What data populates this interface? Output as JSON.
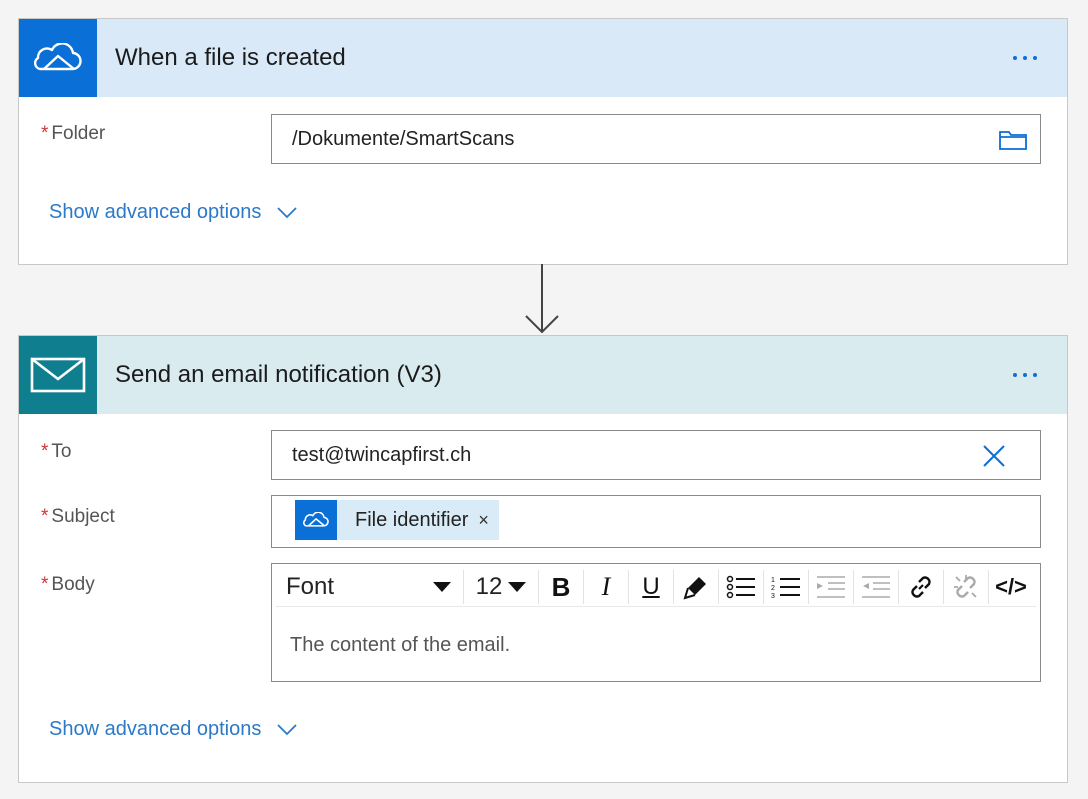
{
  "trigger": {
    "title": "When a file is created",
    "icon": "onedrive-cloud-icon",
    "color": "#0a6fd6",
    "folder_label": "Folder",
    "required_mark": "*",
    "folder_value": "/Dokumente/SmartScans",
    "advanced_label": "Show advanced options"
  },
  "action": {
    "title": "Send an email notification (V3)",
    "icon": "mail-icon",
    "color": "#0f7f8f",
    "required_mark": "*",
    "to_label": "To",
    "to_value": "test@twincapfirst.ch",
    "subject_label": "Subject",
    "subject_token": "File identifier",
    "token_close": "×",
    "body_label": "Body",
    "toolbar": {
      "font": "Font",
      "size": "12",
      "bold": "B",
      "italic": "I",
      "underline": "U",
      "code": "</>"
    },
    "body_text": "The content of the email.",
    "advanced_label": "Show advanced options"
  }
}
